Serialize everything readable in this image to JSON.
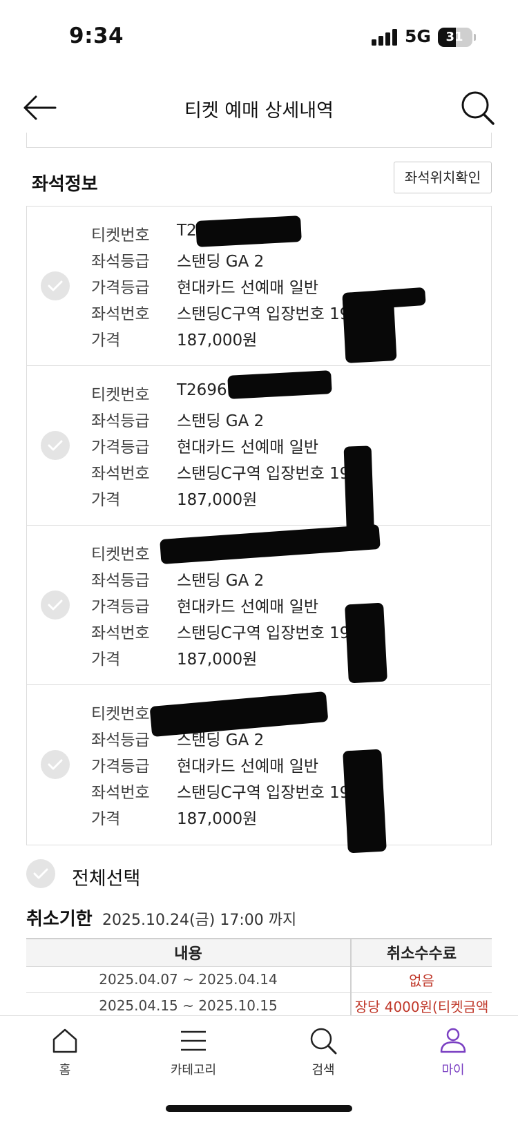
{
  "status_bar": {
    "time": "9:34",
    "network": "5G",
    "battery": "31"
  },
  "header": {
    "title": "티켓 예매 상세내역"
  },
  "seat_section": {
    "title": "좌석정보",
    "seat_position_button": "좌석위치확인",
    "labels": {
      "ticket_no": "티켓번호",
      "seat_grade": "좌석등급",
      "price_grade": "가격등급",
      "seat_no": "좌석번호",
      "price": "가격"
    },
    "tickets": [
      {
        "ticket_no": "T2696527",
        "seat_grade": "스탠딩 GA 2",
        "price_grade": "현대카드 선예매 일반",
        "seat_no": "스탠딩C구역 입장번호 19",
        "price": "187,000원"
      },
      {
        "ticket_no": "T2696",
        "seat_grade": "스탠딩 GA 2",
        "price_grade": "현대카드 선예매 일반",
        "seat_no": "스탠딩C구역 입장번호 19",
        "price": "187,000원"
      },
      {
        "ticket_no": "",
        "seat_grade": "스탠딩 GA 2",
        "price_grade": "현대카드 선예매 일반",
        "seat_no": "스탠딩C구역 입장번호 19",
        "price": "187,000원"
      },
      {
        "ticket_no": "",
        "seat_grade": "스탠딩 GA 2",
        "price_grade": "현대카드 선예매 일반",
        "seat_no": "스탠딩C구역 입장번호 19",
        "price": "187,000원"
      }
    ]
  },
  "select_all": {
    "label": "전체선택"
  },
  "cancel_deadline": {
    "title": "취소기한",
    "value": "2025.10.24(금) 17:00 까지"
  },
  "fee_table": {
    "headers": [
      "내용",
      "취소수수료"
    ],
    "rows": [
      {
        "period": "2025.04.07 ~ 2025.04.14",
        "fee": "없음"
      },
      {
        "period": "2025.04.15 ~ 2025.10.15",
        "fee": "장당 4000원(티켓금액"
      }
    ]
  },
  "tabbar": {
    "items": [
      {
        "label": "홈",
        "icon": "home-icon"
      },
      {
        "label": "카테고리",
        "icon": "menu-icon"
      },
      {
        "label": "검색",
        "icon": "search-icon"
      },
      {
        "label": "마이",
        "icon": "user-icon"
      }
    ],
    "active_color": "#7a3fc2"
  }
}
